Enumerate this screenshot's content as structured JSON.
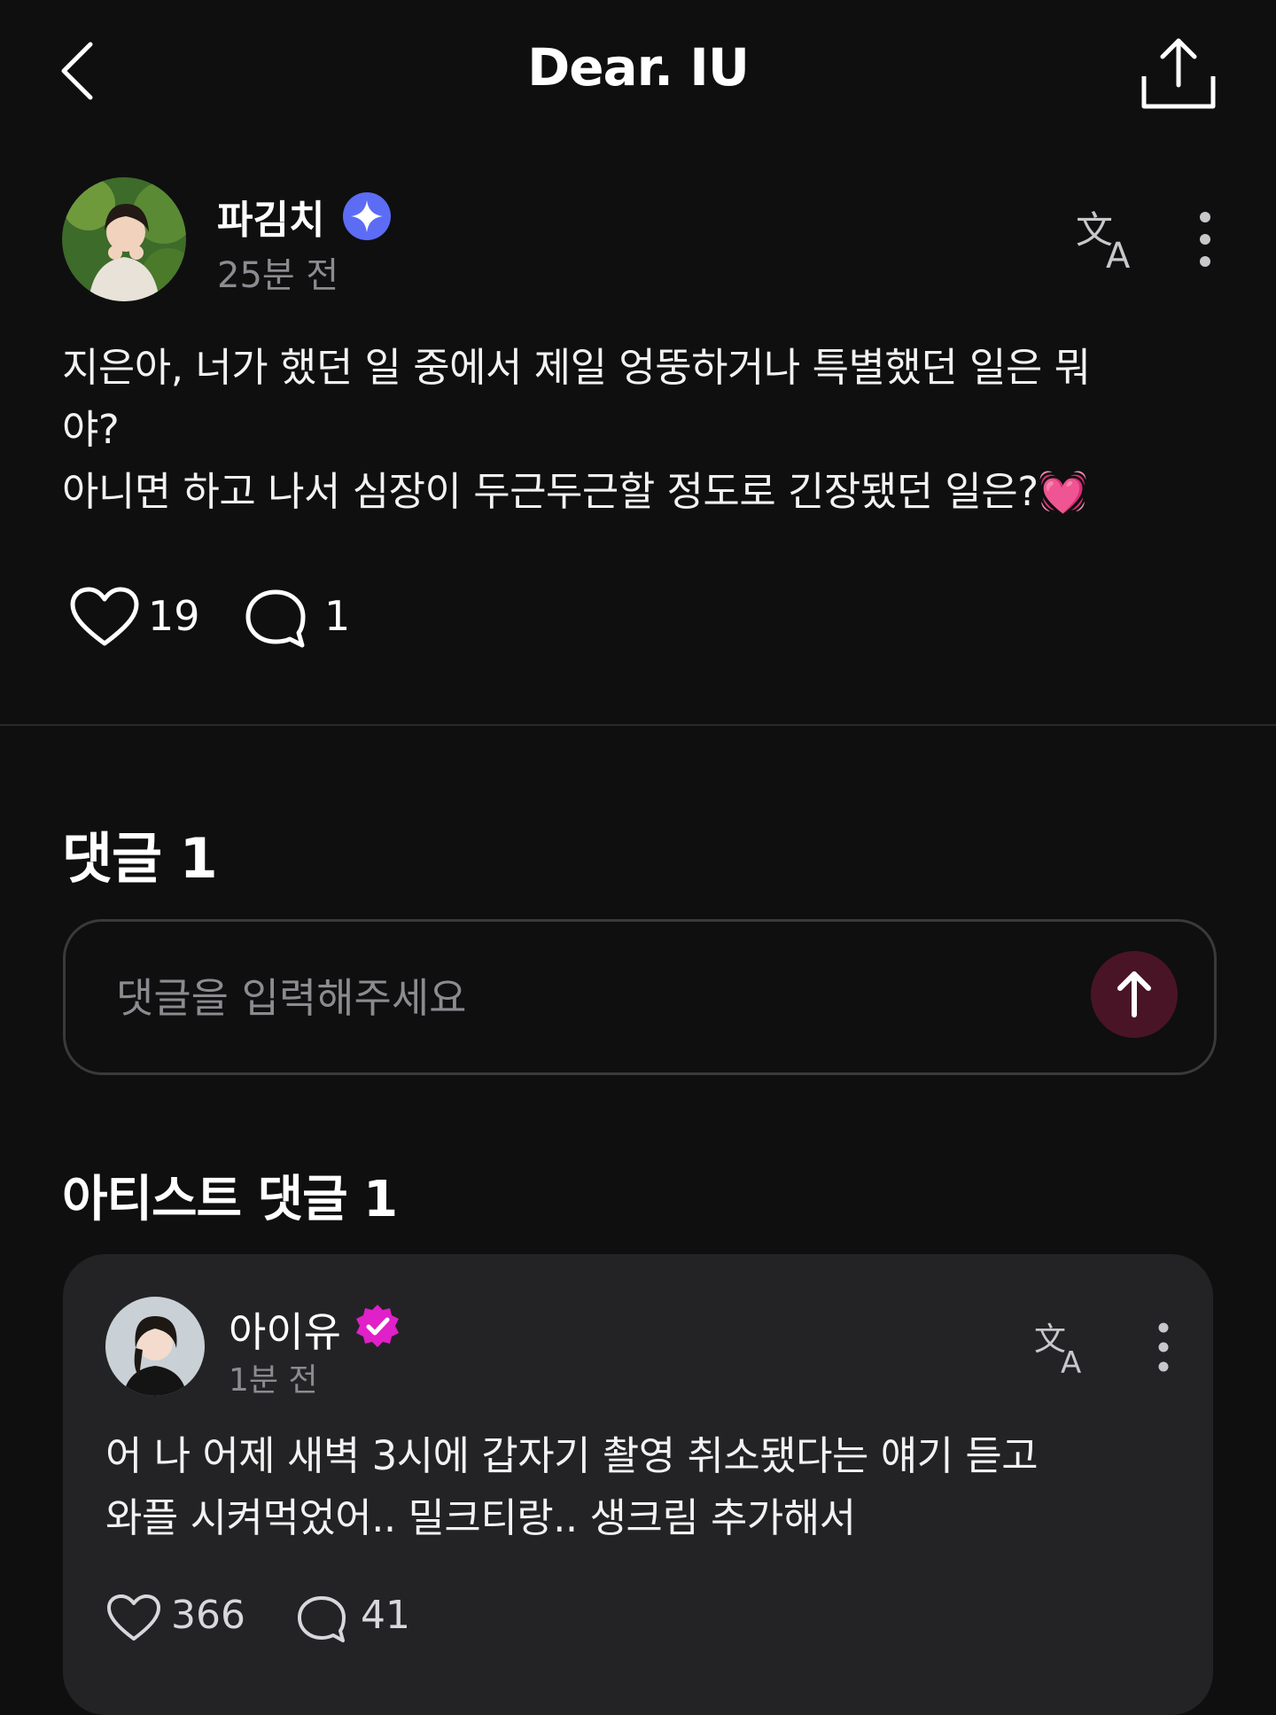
{
  "header": {
    "title": "Dear. IU",
    "back_icon": "chevron-left-icon",
    "share_icon": "share-icon"
  },
  "post": {
    "author": "파김치",
    "time": "25분 전",
    "body_lines": [
      "지은아, 너가 했던 일 중에서 제일 엉뚱하거나 특별했던 일은 뭐",
      "야?",
      "아니면 하고 나서 심장이 두근두근할 정도로 긴장됐던 일은?💓"
    ],
    "likes": "19",
    "comments": "1"
  },
  "comments_section": {
    "heading": "댓글 1",
    "input_placeholder": "댓글을 입력해주세요"
  },
  "artist_section": {
    "heading": "아티스트 댓글 1",
    "comment": {
      "author": "아이유",
      "time": "1분 전",
      "body_lines": [
        "어 나 어제 새벽 3시에 갑자기 촬영 취소됐다는 얘기 듣고",
        "와플 시켜먹었어.. 밀크티랑.. 생크림  추가해서"
      ],
      "likes": "366",
      "comments": "41"
    }
  },
  "colors": {
    "background": "#0f0f10",
    "card": "#232325",
    "verified_blue": "#5c6cf5",
    "verified_pink": "#e020c8",
    "send_button": "#4a1427",
    "muted_text": "#8b8b90"
  }
}
